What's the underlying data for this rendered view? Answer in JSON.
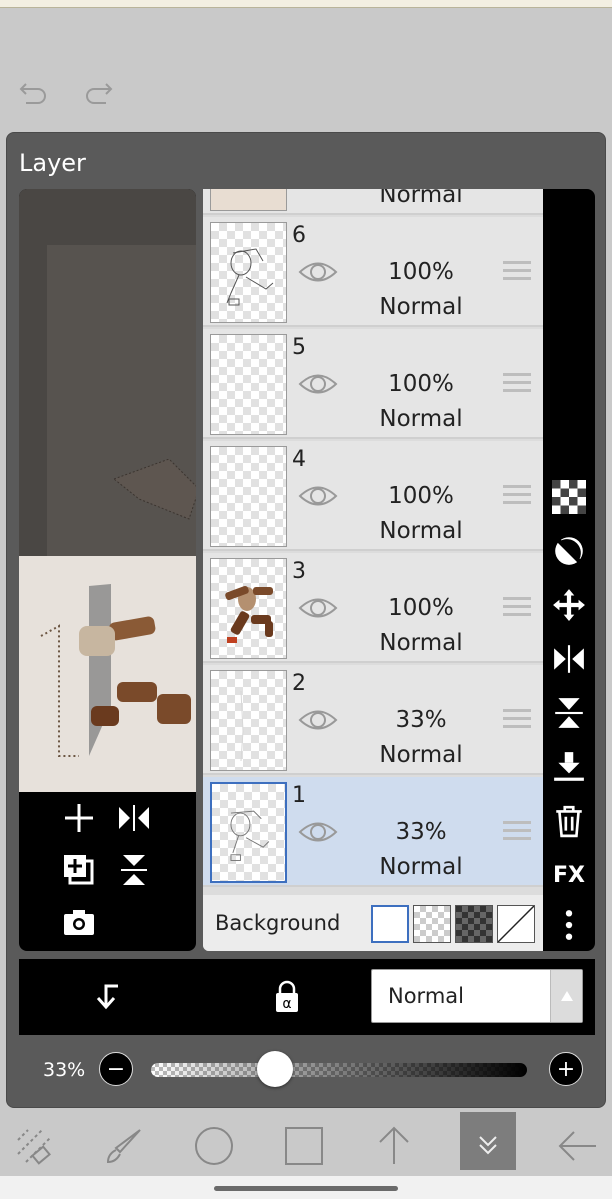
{
  "panel": {
    "title": "Layer"
  },
  "layers": [
    {
      "num": "",
      "opacity": "",
      "blend": "Normal"
    },
    {
      "num": "6",
      "opacity": "100%",
      "blend": "Normal"
    },
    {
      "num": "5",
      "opacity": "100%",
      "blend": "Normal"
    },
    {
      "num": "4",
      "opacity": "100%",
      "blend": "Normal"
    },
    {
      "num": "3",
      "opacity": "100%",
      "blend": "Normal"
    },
    {
      "num": "2",
      "opacity": "33%",
      "blend": "Normal"
    },
    {
      "num": "1",
      "opacity": "33%",
      "blend": "Normal"
    }
  ],
  "background": {
    "label": "Background"
  },
  "blend_mode": {
    "value": "Normal"
  },
  "opacity": {
    "value": "33%",
    "fraction": 0.33
  },
  "right_tools": {
    "fx": "FX"
  },
  "colors": {
    "panel": "#5a5a5a",
    "selected_row": "#cfdcee",
    "accent": "#3d6fbf"
  }
}
